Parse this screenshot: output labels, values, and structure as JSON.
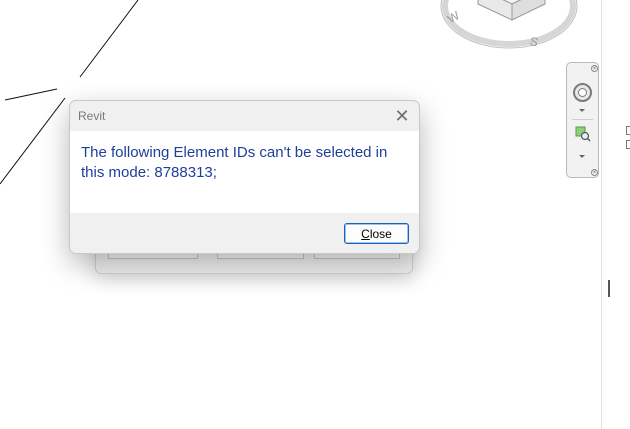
{
  "dialog": {
    "title": "Revit",
    "close_icon": "close-icon",
    "message": "The following Element IDs can't be selected in this mode: 8788313;",
    "close_button": {
      "mnemonic": "C",
      "rest": "lose"
    }
  },
  "view_cube": {
    "compass_labels": [
      "W",
      "S"
    ]
  },
  "navigation_bar": {
    "icons": [
      "close-icon",
      "full-navigation-wheel-icon",
      "zoom-region-icon"
    ]
  },
  "colors": {
    "dialog_text": "#1e3f9a",
    "button_border": "#1f5fbf",
    "dialog_bg": "#f0f0f0"
  }
}
